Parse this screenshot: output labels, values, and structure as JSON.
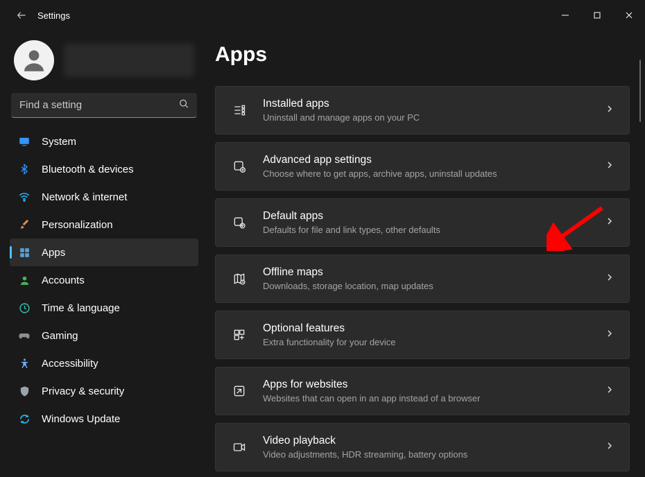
{
  "window": {
    "title": "Settings"
  },
  "search": {
    "placeholder": "Find a setting"
  },
  "sidebar": {
    "items": [
      {
        "label": "System"
      },
      {
        "label": "Bluetooth & devices"
      },
      {
        "label": "Network & internet"
      },
      {
        "label": "Personalization"
      },
      {
        "label": "Apps"
      },
      {
        "label": "Accounts"
      },
      {
        "label": "Time & language"
      },
      {
        "label": "Gaming"
      },
      {
        "label": "Accessibility"
      },
      {
        "label": "Privacy & security"
      },
      {
        "label": "Windows Update"
      }
    ]
  },
  "page": {
    "title": "Apps",
    "cards": [
      {
        "title": "Installed apps",
        "desc": "Uninstall and manage apps on your PC"
      },
      {
        "title": "Advanced app settings",
        "desc": "Choose where to get apps, archive apps, uninstall updates"
      },
      {
        "title": "Default apps",
        "desc": "Defaults for file and link types, other defaults"
      },
      {
        "title": "Offline maps",
        "desc": "Downloads, storage location, map updates"
      },
      {
        "title": "Optional features",
        "desc": "Extra functionality for your device"
      },
      {
        "title": "Apps for websites",
        "desc": "Websites that can open in an app instead of a browser"
      },
      {
        "title": "Video playback",
        "desc": "Video adjustments, HDR streaming, battery options"
      }
    ]
  },
  "annotation": {
    "arrow_color": "#ff0000"
  }
}
